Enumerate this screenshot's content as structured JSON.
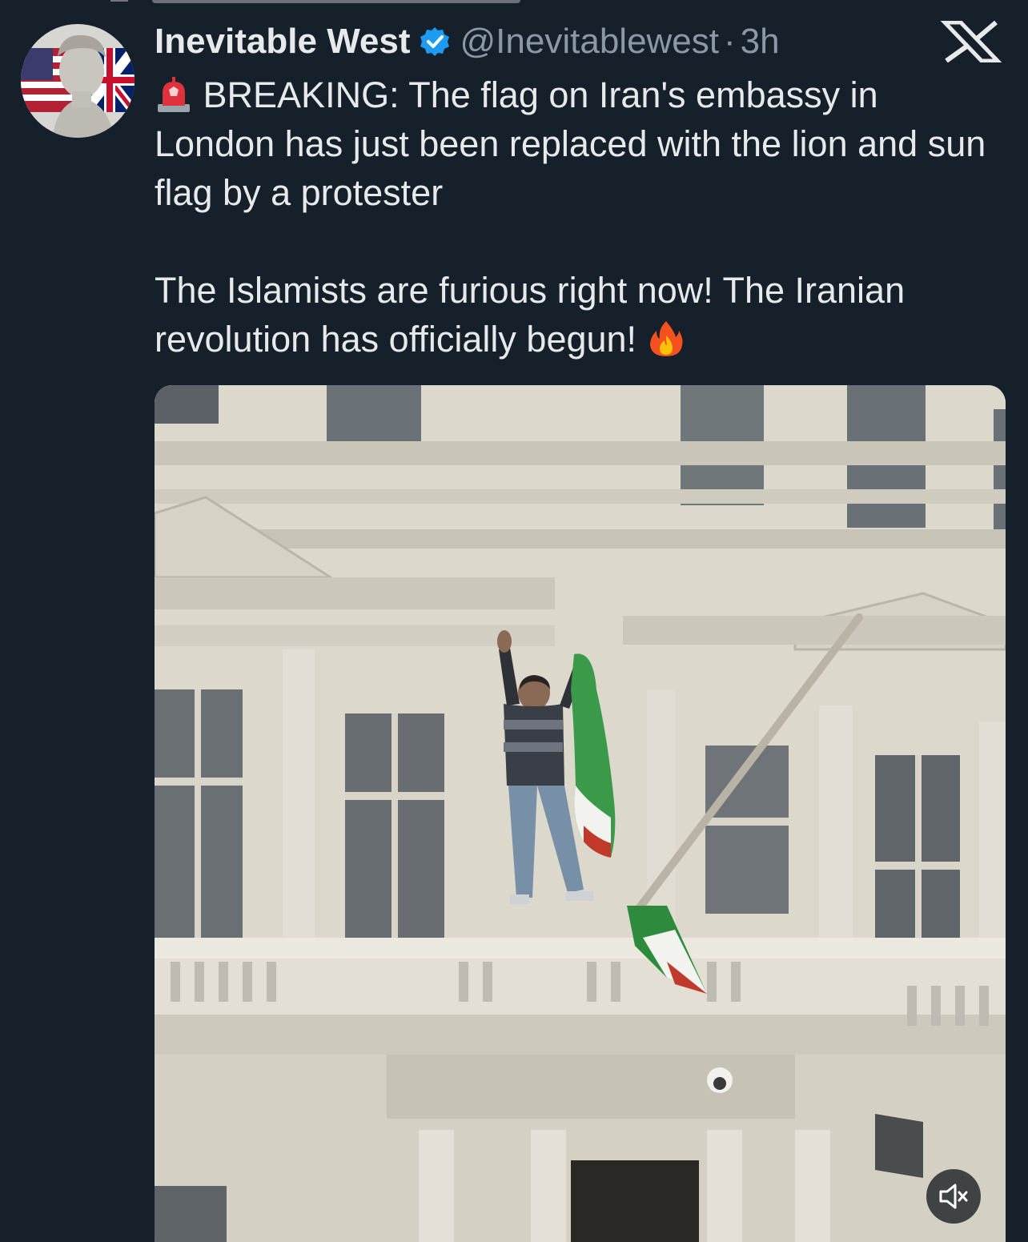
{
  "post": {
    "author_name": "Inevitable West",
    "handle": "@Inevitablewest",
    "separator": "·",
    "time": "3h",
    "text_line_1": "BREAKING: The flag on Iran's embassy in London has just been replaced with the lion and sun flag by a protester",
    "text_line_2": "The Islamists are furious right now! The Iranian revolution has officially begun!"
  },
  "icons": {
    "verified": "verified-badge-icon",
    "x_logo": "x-logo-icon",
    "siren": "police-light-emoji",
    "fire": "fire-emoji",
    "mute": "speaker-muted-icon"
  },
  "colors": {
    "background": "#15202b",
    "text": "#e7e9ea",
    "secondary_text": "#8b98a5",
    "verified": "#1d9bf0"
  }
}
